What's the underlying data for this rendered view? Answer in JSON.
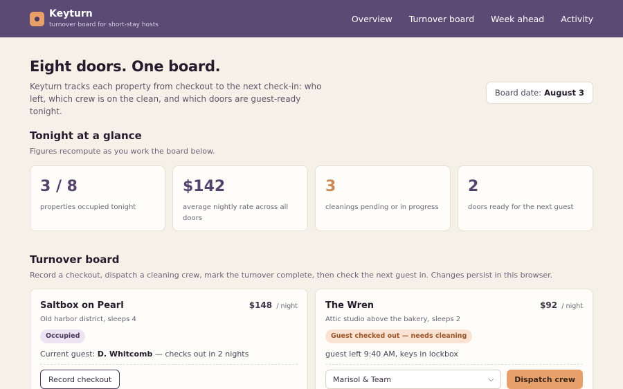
{
  "app": {
    "name": "Keyturn",
    "tagline": "turnover board for short-stay hosts"
  },
  "nav": [
    "Overview",
    "Turnover board",
    "Week ahead",
    "Activity"
  ],
  "hero": {
    "title": "Eight doors. One board.",
    "description": "Keyturn tracks each property from checkout to the next check-in: who left, which crew is on the clean, and which doors are guest-ready tonight.",
    "board_date_label": "Board date:",
    "board_date_value": "August 3"
  },
  "glance": {
    "title": "Tonight at a glance",
    "subtitle": "Figures recompute as you work the board below.",
    "stats": [
      {
        "value": "3 / 8",
        "label": "properties occupied tonight"
      },
      {
        "value": "$142",
        "label": "average nightly rate across all doors"
      },
      {
        "value": "3",
        "label": "cleanings pending or in progress"
      },
      {
        "value": "2",
        "label": "doors ready for the next guest"
      }
    ]
  },
  "board": {
    "title": "Turnover board",
    "subtitle": "Record a checkout, dispatch a cleaning crew, mark the turnover complete, then check the next guest in. Changes persist in this browser.",
    "cards": [
      {
        "name": "Saltbox on Pearl",
        "price": "$148",
        "price_unit": "/ night",
        "description": "Old harbor district, sleeps 4",
        "status": "Occupied",
        "note_prefix": "Current guest:",
        "guest": "D. Whitcomb",
        "note_suffix": "— checks out in 2 nights",
        "action_label": "Record checkout"
      },
      {
        "name": "The Wren",
        "price": "$92",
        "price_unit": "/ night",
        "description": "Attic studio above the bakery, sleeps 2",
        "status": "Guest checked out — needs cleaning",
        "note": "guest left 9:40 AM, keys in lockbox",
        "crew_selected": "Marisol & Team",
        "action_label": "Dispatch crew"
      }
    ]
  },
  "colors": {
    "header_bg": "#5b4a73",
    "accent": "#e8a06a",
    "page_bg": "#f6f1e8"
  }
}
